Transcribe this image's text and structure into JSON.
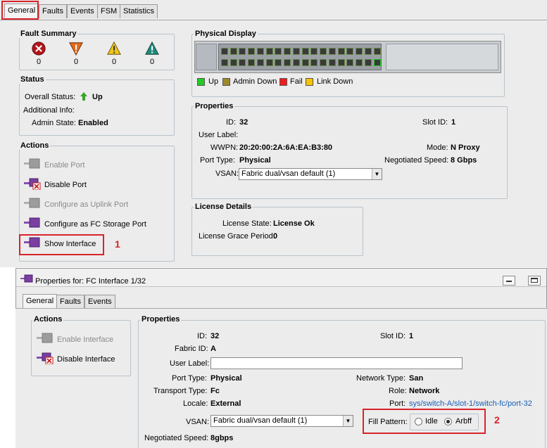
{
  "top_tabs": [
    {
      "label": "General",
      "active": true
    },
    {
      "label": "Faults",
      "active": false
    },
    {
      "label": "Events",
      "active": false
    },
    {
      "label": "FSM",
      "active": false
    },
    {
      "label": "Statistics",
      "active": false
    }
  ],
  "fault_summary": {
    "title": "Fault Summary",
    "counts": [
      "0",
      "0",
      "0",
      "0"
    ]
  },
  "status": {
    "title": "Status",
    "overall_label": "Overall Status:",
    "overall_value": "Up",
    "additional_label": "Additional Info:",
    "admin_label": "Admin State:",
    "admin_value": "Enabled"
  },
  "actions": {
    "title": "Actions",
    "items": [
      {
        "label": "Enable Port",
        "enabled": false
      },
      {
        "label": "Disable Port",
        "enabled": true
      },
      {
        "label": "Configure as Uplink Port",
        "enabled": false
      },
      {
        "label": "Configure as FC Storage Port",
        "enabled": true
      },
      {
        "label": "Show Interface",
        "enabled": true
      }
    ]
  },
  "physical_display": {
    "title": "Physical Display",
    "legend": [
      "Up",
      "Admin Down",
      "Fail",
      "Link Down"
    ],
    "legend_colors": [
      "#22cc22",
      "#9c8a2a",
      "#ee1c1c",
      "#f5c400"
    ]
  },
  "properties": {
    "title": "Properties",
    "id_label": "ID:",
    "id_value": "32",
    "slot_label": "Slot ID:",
    "slot_value": "1",
    "user_label": "User Label:",
    "wwpn_label": "WWPN:",
    "wwpn_value": "20:20:00:2A:6A:EA:B3:80",
    "mode_label": "Mode:",
    "mode_value": "N Proxy",
    "port_type_label": "Port Type:",
    "port_type_value": "Physical",
    "neg_speed_label": "Negotiated Speed:",
    "neg_speed_value": "8 Gbps",
    "vsan_label": "VSAN:",
    "vsan_value": "Fabric dual/vsan default (1)"
  },
  "license": {
    "title": "License Details",
    "state_label": "License State:",
    "state_value": "License Ok",
    "grace_label": "License Grace Period:",
    "grace_value": "0"
  },
  "annotations": [
    "1",
    "2"
  ],
  "interface_window": {
    "title": "Properties for: FC Interface 1/32",
    "tabs": [
      {
        "label": "General",
        "active": true
      },
      {
        "label": "Faults",
        "active": false
      },
      {
        "label": "Events",
        "active": false
      }
    ],
    "actions": {
      "title": "Actions",
      "items": [
        "Enable Interface",
        "Disable Interface"
      ]
    },
    "properties": {
      "title": "Properties",
      "id_label": "ID:",
      "id_value": "32",
      "slot_label": "Slot ID:",
      "slot_value": "1",
      "fabric_label": "Fabric ID:",
      "fabric_value": "A",
      "user_label": "User Label:",
      "user_value": "",
      "port_type_label": "Port Type:",
      "port_type_value": "Physical",
      "network_type_label": "Network Type:",
      "network_type_value": "San",
      "transport_label": "Transport Type:",
      "transport_value": "Fc",
      "role_label": "Role:",
      "role_value": "Network",
      "locale_label": "Locale:",
      "locale_value": "External",
      "port_label": "Port:",
      "port_value": "sys/switch-A/slot-1/switch-fc/port-32",
      "vsan_label": "VSAN:",
      "vsan_value": "Fabric dual/vsan default (1)",
      "fill_label": "Fill Pattern:",
      "fill_options": [
        "Idle",
        "Arbff"
      ],
      "fill_selected": "Arbff",
      "neg_speed_label": "Negotiated Speed:",
      "neg_speed_value": "8gbps"
    }
  }
}
